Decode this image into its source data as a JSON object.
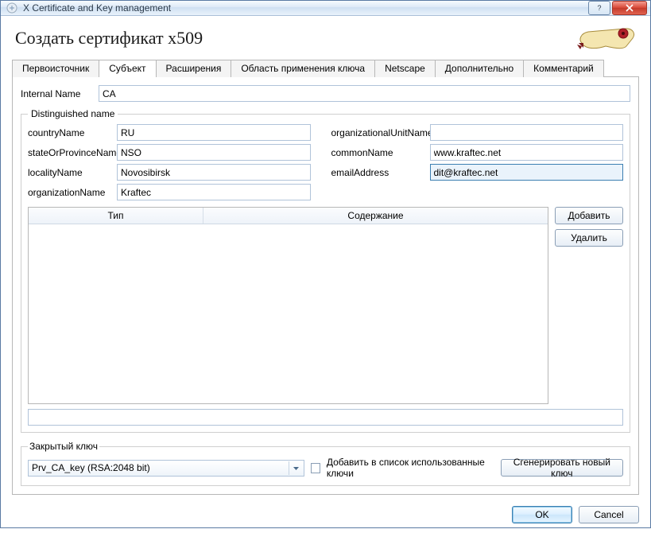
{
  "window": {
    "title": "X Certificate and Key management"
  },
  "header": {
    "title": "Создать сертификат x509"
  },
  "tabs": [
    {
      "label": "Первоисточник",
      "active": false
    },
    {
      "label": "Субъект",
      "active": true
    },
    {
      "label": "Расширения",
      "active": false
    },
    {
      "label": "Область применения ключа",
      "active": false
    },
    {
      "label": "Netscape",
      "active": false
    },
    {
      "label": "Дополнительно",
      "active": false
    },
    {
      "label": "Комментарий",
      "active": false
    }
  ],
  "internal": {
    "label": "Internal Name",
    "value": "CA"
  },
  "dn": {
    "legend": "Distinguished name",
    "fields": {
      "countryName": {
        "label": "countryName",
        "value": "RU"
      },
      "organizationalUnitName": {
        "label": "organizationalUnitName",
        "value": ""
      },
      "stateOrProvinceName": {
        "label": "stateOrProvinceName",
        "value": "NSO"
      },
      "commonName": {
        "label": "commonName",
        "value": "www.kraftec.net"
      },
      "localityName": {
        "label": "localityName",
        "value": "Novosibirsk"
      },
      "emailAddress": {
        "label": "emailAddress",
        "value": "dit@kraftec.net"
      },
      "organizationName": {
        "label": "organizationName",
        "value": "Kraftec"
      }
    },
    "tableHeaders": {
      "type": "Тип",
      "content": "Содержание"
    },
    "buttons": {
      "add": "Добавить",
      "delete": "Удалить"
    },
    "extraLine": ""
  },
  "pk": {
    "legend": "Закрытый ключ",
    "selected": "Prv_CA_key (RSA:2048 bit)",
    "reuseLabel": "Добавить в список использованные ключи",
    "generate": "Сгенерировать новый ключ"
  },
  "footer": {
    "ok": "OK",
    "cancel": "Cancel"
  }
}
